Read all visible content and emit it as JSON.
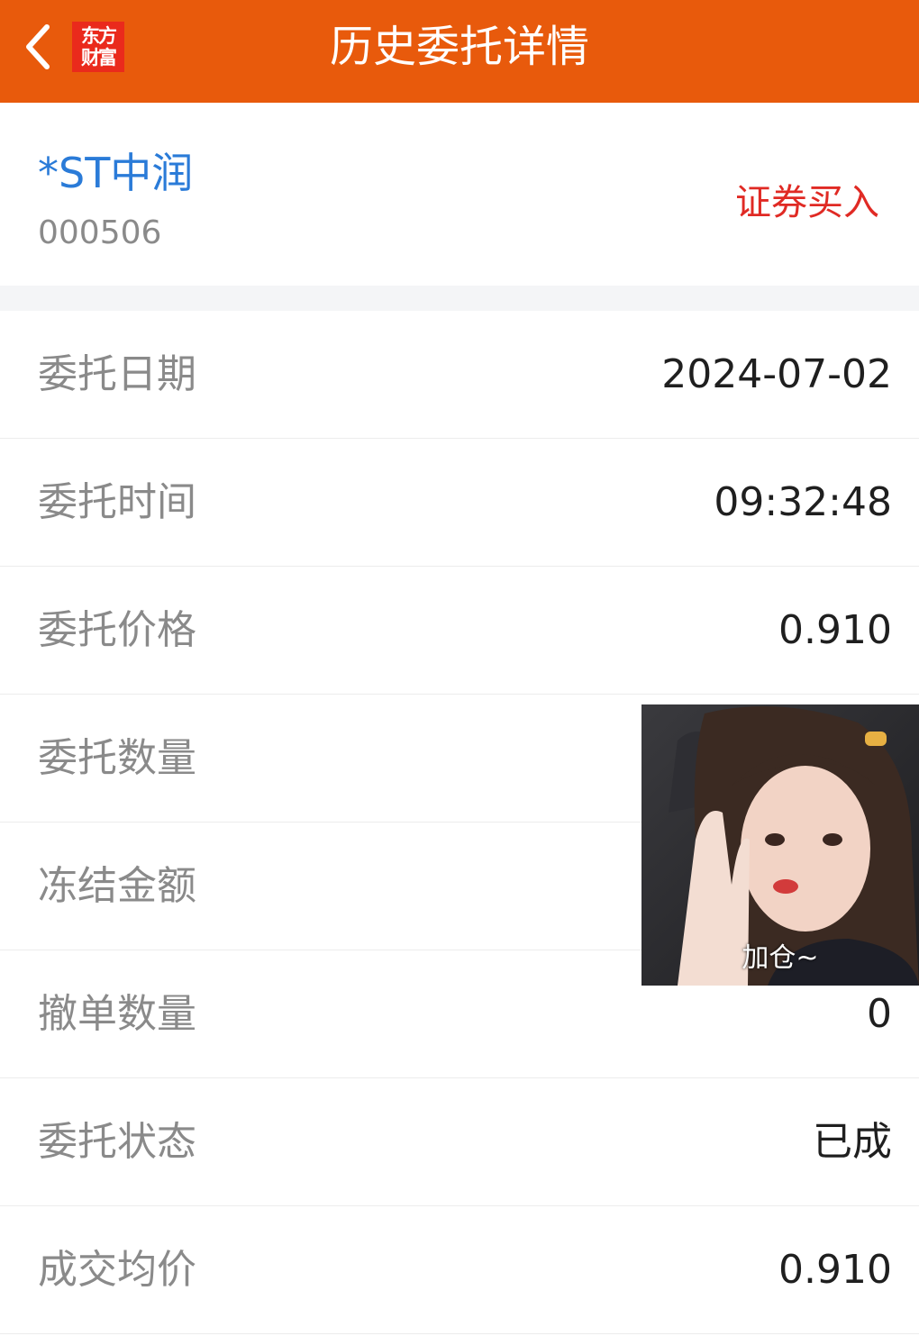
{
  "header": {
    "title": "历史委托详情",
    "logo_line1": "东方",
    "logo_line2": "财富",
    "accent_color": "#e85a0c"
  },
  "stock": {
    "name": "*ST中润",
    "code": "000506",
    "trade_type": "证券买入"
  },
  "details": [
    {
      "label": "委托日期",
      "value": "2024-07-02"
    },
    {
      "label": "委托时间",
      "value": "09:32:48"
    },
    {
      "label": "委托价格",
      "value": "0.910"
    },
    {
      "label": "委托数量",
      "value": ""
    },
    {
      "label": "冻结金额",
      "value": ""
    },
    {
      "label": "撤单数量",
      "value": "0"
    },
    {
      "label": "委托状态",
      "value": "已成"
    },
    {
      "label": "成交均价",
      "value": "0.910"
    }
  ],
  "sticker": {
    "caption": "加仓~"
  }
}
